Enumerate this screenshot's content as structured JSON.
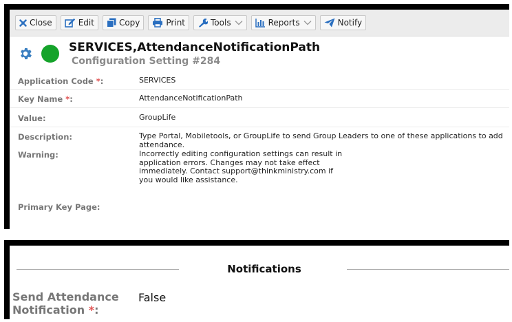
{
  "toolbar": {
    "close": "Close",
    "edit": "Edit",
    "copy": "Copy",
    "print": "Print",
    "tools": "Tools",
    "reports": "Reports",
    "notify": "Notify"
  },
  "header": {
    "title": "SERVICES,AttendanceNotificationPath",
    "subtitle": "Configuration Setting #284"
  },
  "fields": {
    "application_code": {
      "label": "Application Code",
      "value": "SERVICES"
    },
    "key_name": {
      "label": "Key Name",
      "value": "AttendanceNotificationPath"
    },
    "value": {
      "label": "Value:",
      "value": "GroupLife"
    },
    "description": {
      "label": "Description:",
      "value": "Type Portal, Mobiletools, or GroupLife to send Group Leaders to one of these applications to add attendance."
    },
    "warning": {
      "label": "Warning:",
      "value": "Incorrectly editing configuration settings can result in application errors. Changes may not take effect immediately. Contact support@thinkministry.com if you would like assistance."
    },
    "primary_key_page": {
      "label": "Primary Key Page:"
    }
  },
  "required_mark": "*",
  "label_colon": ":",
  "notifications": {
    "title": "Notifications",
    "send_label_line1": "Send Attendance",
    "send_label_line2": "Notification",
    "send_value": "False"
  },
  "colors": {
    "status_dot": "#15a32a",
    "gear": "#3a7fc1",
    "required": "#e05050",
    "label": "#777777"
  }
}
